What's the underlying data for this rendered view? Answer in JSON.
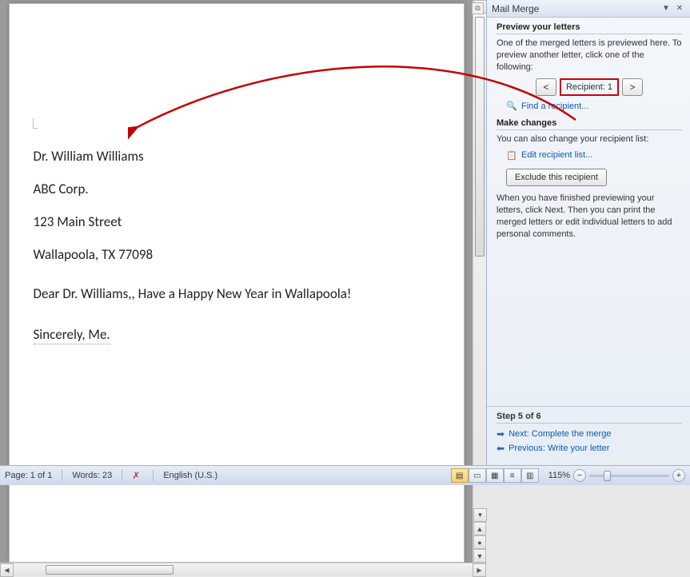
{
  "document": {
    "name_line": "Dr. William Williams",
    "company_line": "ABC Corp.",
    "street_line": "123 Main Street",
    "city_line": "Wallapoola, TX 77098",
    "greeting_line": "Dear Dr. Williams,, Have a Happy New Year in Wallapoola!",
    "closing_line": "Sincerely, Me."
  },
  "pane": {
    "title": "Mail Merge",
    "preview": {
      "heading": "Preview your letters",
      "text": "One of the merged letters is previewed here. To preview another letter, click one of the following:",
      "prev": "<",
      "recipient_label": "Recipient: 1",
      "next": ">",
      "find_link": "Find a recipient..."
    },
    "changes": {
      "heading": "Make changes",
      "text1": "You can also change your recipient list:",
      "edit_link": "Edit recipient list...",
      "exclude_btn": "Exclude this recipient",
      "text2": "When you have finished previewing your letters, click Next. Then you can print the merged letters or edit individual letters to add personal comments."
    },
    "footer": {
      "step": "Step 5 of 6",
      "next": "Next: Complete the merge",
      "prev": "Previous: Write your letter"
    }
  },
  "status": {
    "page": "Page: 1 of 1",
    "words": "Words: 23",
    "language": "English (U.S.)",
    "zoom": "115%"
  }
}
